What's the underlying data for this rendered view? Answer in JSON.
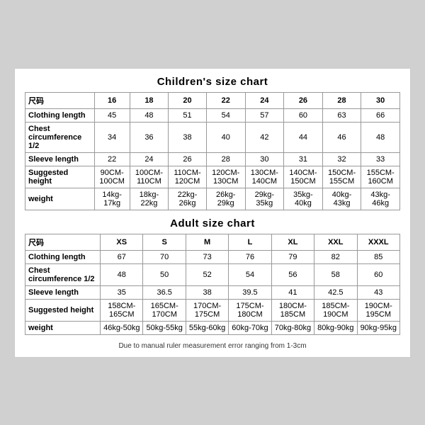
{
  "children_title": "Children's size chart",
  "adult_title": "Adult size chart",
  "note": "Due to manual ruler measurement error ranging from 1-3cm",
  "children": {
    "headers": [
      "尺码",
      "16",
      "18",
      "20",
      "22",
      "24",
      "26",
      "28",
      "30"
    ],
    "rows": [
      {
        "label": "Clothing length",
        "values": [
          "45",
          "48",
          "51",
          "54",
          "57",
          "60",
          "63",
          "66"
        ]
      },
      {
        "label": "Chest circumference 1/2",
        "values": [
          "34",
          "36",
          "38",
          "40",
          "42",
          "44",
          "46",
          "48"
        ]
      },
      {
        "label": "Sleeve length",
        "values": [
          "22",
          "24",
          "26",
          "28",
          "30",
          "31",
          "32",
          "33"
        ]
      },
      {
        "label": "Suggested height",
        "values": [
          "90CM-100CM",
          "100CM-110CM",
          "110CM-120CM",
          "120CM-130CM",
          "130CM-140CM",
          "140CM-150CM",
          "150CM-155CM",
          "155CM-160CM"
        ]
      },
      {
        "label": "weight",
        "values": [
          "14kg-17kg",
          "18kg-22kg",
          "22kg-26kg",
          "26kg-29kg",
          "29kg-35kg",
          "35kg-40kg",
          "40kg-43kg",
          "43kg-46kg"
        ]
      }
    ]
  },
  "adult": {
    "headers": [
      "尺码",
      "XS",
      "S",
      "M",
      "L",
      "XL",
      "XXL",
      "XXXL"
    ],
    "rows": [
      {
        "label": "Clothing length",
        "values": [
          "67",
          "70",
          "73",
          "76",
          "79",
          "82",
          "85"
        ]
      },
      {
        "label": "Chest circumference 1/2",
        "values": [
          "48",
          "50",
          "52",
          "54",
          "56",
          "58",
          "60"
        ]
      },
      {
        "label": "Sleeve length",
        "values": [
          "35",
          "36.5",
          "38",
          "39.5",
          "41",
          "42.5",
          "43"
        ]
      },
      {
        "label": "Suggested height",
        "values": [
          "158CM-165CM",
          "165CM-170CM",
          "170CM-175CM",
          "175CM-180CM",
          "180CM-185CM",
          "185CM-190CM",
          "190CM-195CM"
        ]
      },
      {
        "label": "weight",
        "values": [
          "46kg-50kg",
          "50kg-55kg",
          "55kg-60kg",
          "60kg-70kg",
          "70kg-80kg",
          "80kg-90kg",
          "90kg-95kg"
        ]
      }
    ]
  }
}
